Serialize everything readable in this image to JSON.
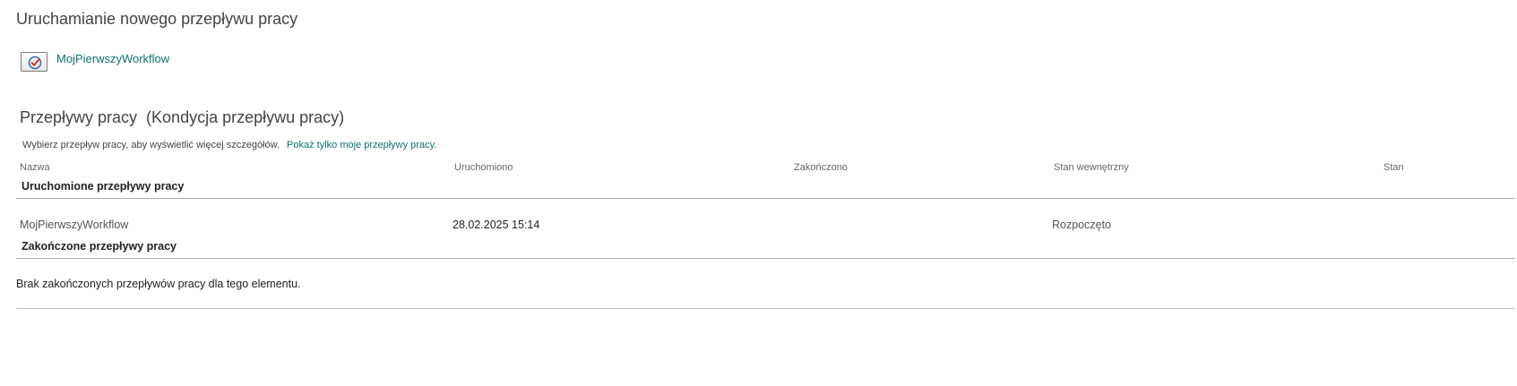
{
  "start_section": {
    "title": "Uruchamianie nowego przepływu pracy",
    "workflow_link": "MojPierwszyWorkflow",
    "workflow_icon": "workflow-start-icon"
  },
  "workflows_section": {
    "title": "Przepływy pracy",
    "subtitle": "(Kondycja przepływu pracy)",
    "hint": "Wybierz przepływ pracy, aby wyświetlić więcej szczegółów.",
    "hint_link": "Pokaż tylko moje przepływy pracy.",
    "columns": [
      "Nazwa",
      "Uruchomiono",
      "Zakończono",
      "Stan wewnętrzny",
      "Stan"
    ],
    "running_group": {
      "label": "Uruchomione przepływy pracy",
      "rows": [
        {
          "name": "MojPierwszyWorkflow",
          "started": "28.02.2025 15:14",
          "finished": "",
          "internal_state": "Rozpoczęto",
          "state": ""
        }
      ]
    },
    "completed_group": {
      "label": "Zakończone przepływy pracy",
      "empty_message": "Brak zakończonych przepływów pracy dla tego elementu."
    }
  },
  "colors": {
    "link": "#0f7170",
    "text": "#333333",
    "heading": "#444444",
    "rule": "#ababab"
  }
}
